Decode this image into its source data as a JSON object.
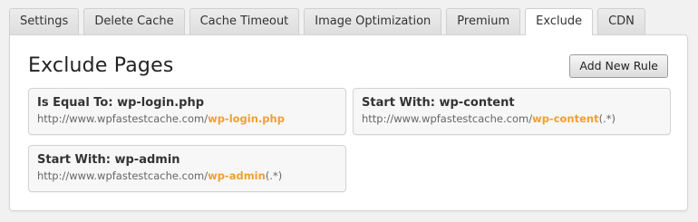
{
  "tabs": [
    {
      "label": "Settings",
      "active": false
    },
    {
      "label": "Delete Cache",
      "active": false
    },
    {
      "label": "Cache Timeout",
      "active": false
    },
    {
      "label": "Image Optimization",
      "active": false
    },
    {
      "label": "Premium",
      "active": false
    },
    {
      "label": "Exclude",
      "active": true
    },
    {
      "label": "CDN",
      "active": false
    }
  ],
  "panel": {
    "title": "Exclude Pages",
    "add_button_label": "Add New Rule"
  },
  "rules": [
    {
      "title": "Is Equal To: wp-login.php",
      "url_prefix": "http://www.wpfastestcache.com/",
      "url_highlight": "wp-login.php",
      "url_suffix": ""
    },
    {
      "title": "Start With: wp-content",
      "url_prefix": "http://www.wpfastestcache.com/",
      "url_highlight": "wp-content",
      "url_suffix": "(.*)"
    },
    {
      "title": "Start With: wp-admin",
      "url_prefix": "http://www.wpfastestcache.com/",
      "url_highlight": "wp-admin",
      "url_suffix": "(.*)"
    }
  ],
  "colors": {
    "highlight": "#f0a030",
    "panel_bg": "#ffffff",
    "page_bg": "#f1f1f1"
  }
}
